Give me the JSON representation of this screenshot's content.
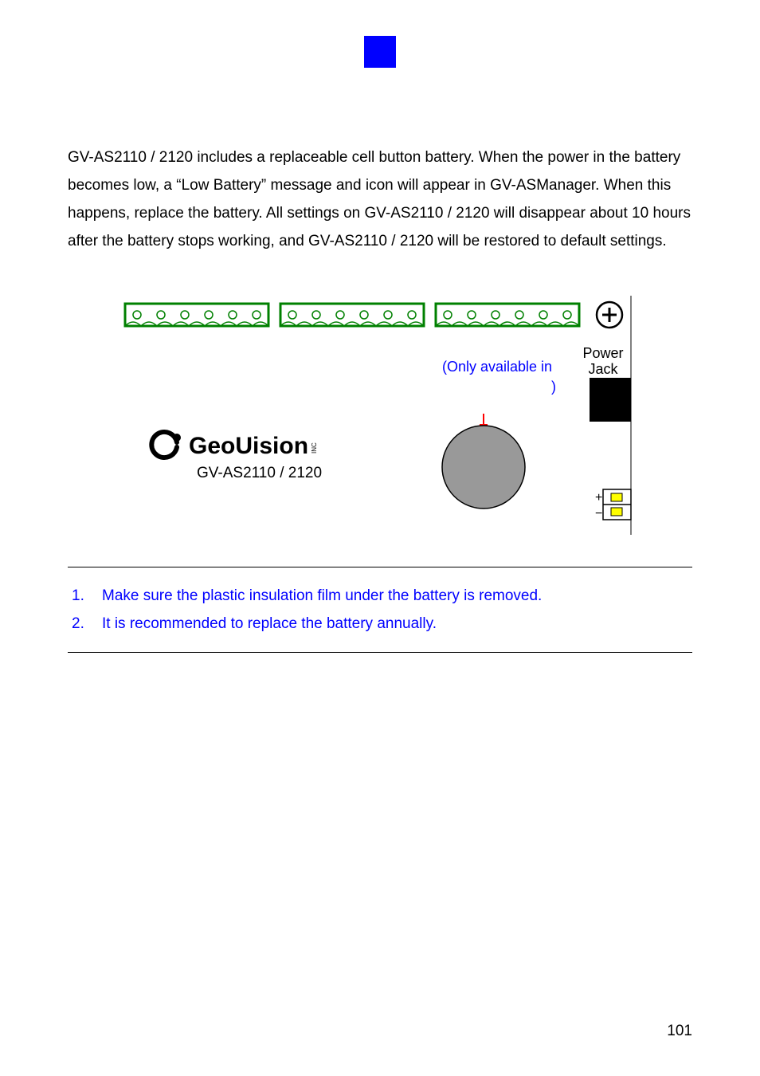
{
  "body_text": "GV-AS2110 / 2120  includes a replaceable cell button battery. When the power in the battery becomes low, a “Low Battery” message and icon will appear in GV-ASManager. When this happens, replace the battery. All settings on GV-AS2110 / 2120  will disappear about 10 hours after the battery stops working, and GV-AS2110 / 2120 will be restored to default settings.",
  "diagram": {
    "note_line1": "(Only available in ",
    "note_line2": ")",
    "power_label_l1": "Power",
    "power_label_l2": "Jack",
    "logo_text": "GeoUision",
    "logo_sub": "GV-AS2110 / 2120",
    "plus": "+",
    "minus": "−"
  },
  "notes": [
    {
      "num": "1.",
      "text": "Make sure the plastic insulation film under the battery is removed."
    },
    {
      "num": "2.",
      "text": "It is recommended to replace the battery annually."
    }
  ],
  "page_number": "101"
}
